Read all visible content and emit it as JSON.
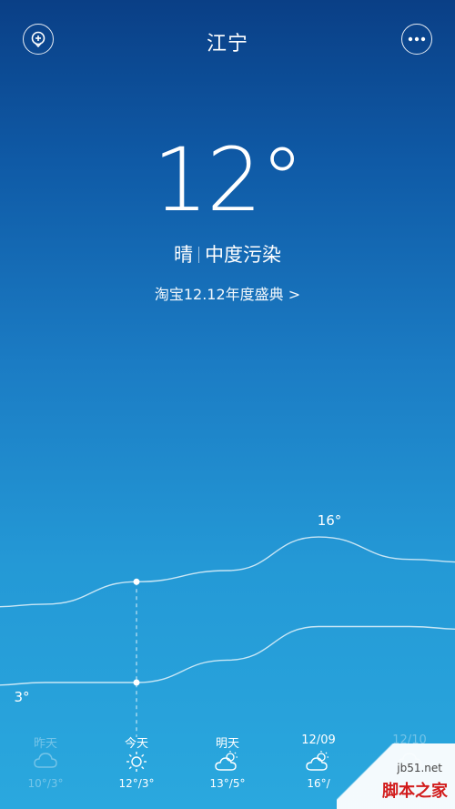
{
  "header": {
    "city": "江宁"
  },
  "current": {
    "temperature": "12°",
    "condition": "晴",
    "air_quality": "中度污染",
    "promo": "淘宝12.12年度盛典 >"
  },
  "chart_data": {
    "type": "line",
    "categories": [
      "昨天",
      "今天",
      "明天",
      "12/09",
      "12/10"
    ],
    "series": [
      {
        "values": [
          10,
          12,
          13,
          16,
          14
        ]
      },
      {
        "values": [
          3,
          3,
          5,
          8,
          8
        ]
      }
    ],
    "annotations": [
      "16°",
      "3°"
    ]
  },
  "forecast": [
    {
      "label": "昨天",
      "icon": "cloud-icon",
      "temps": "10°/3°",
      "faded": true
    },
    {
      "label": "今天",
      "icon": "sun-icon",
      "temps": "12°/3°",
      "faded": false
    },
    {
      "label": "明天",
      "icon": "partly-cloudy-icon",
      "temps": "13°/5°",
      "faded": false
    },
    {
      "label": "12/09",
      "icon": "partly-cloudy-icon",
      "temps": "16°/",
      "faded": false
    },
    {
      "label": "12/10",
      "icon": "cloud-icon",
      "temps": "",
      "faded": true
    }
  ],
  "watermark": {
    "site": "jb51.net",
    "name": "脚本之家"
  },
  "colors": {
    "bg_top": "#0a3f86",
    "bg_bottom": "#2aa8de",
    "watermark_red": "#d21c1c"
  }
}
